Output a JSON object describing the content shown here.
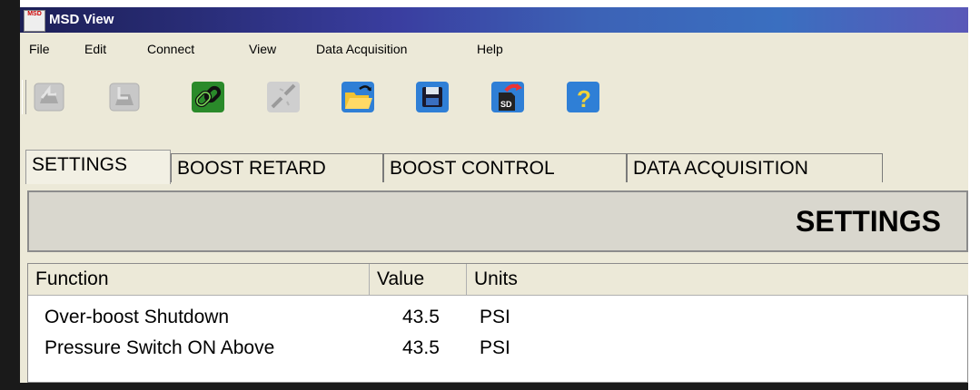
{
  "window": {
    "title": "MSD View",
    "icon_text": "MSD"
  },
  "menu": [
    "File",
    "Edit",
    "Connect",
    "View",
    "Data Acquisition",
    "Help"
  ],
  "toolbar": {
    "buttons": [
      {
        "icon": "read-from-device-icon",
        "enabled": false
      },
      {
        "icon": "write-to-device-icon",
        "enabled": false
      },
      {
        "icon": "connect-chain-icon",
        "enabled": true
      },
      {
        "icon": "disconnect-icon",
        "enabled": false
      },
      {
        "icon": "open-folder-icon",
        "enabled": true
      },
      {
        "icon": "save-floppy-icon",
        "enabled": true
      },
      {
        "icon": "sd-card-export-icon",
        "enabled": true,
        "label": "SD"
      },
      {
        "icon": "help-question-icon",
        "enabled": true,
        "label": "?"
      }
    ]
  },
  "tabs": [
    "SETTINGS",
    "BOOST RETARD",
    "BOOST CONTROL",
    "DATA ACQUISITION"
  ],
  "active_tab": "SETTINGS",
  "banner": {
    "title": "SETTINGS"
  },
  "table": {
    "columns": [
      "Function",
      "Value",
      "Units"
    ],
    "rows": [
      {
        "function": "Over-boost Shutdown",
        "value": "43.5",
        "units": "PSI"
      },
      {
        "function": "Pressure Switch ON Above",
        "value": "43.5",
        "units": "PSI"
      }
    ]
  },
  "colors": {
    "titlebar_start": "#1c1f56",
    "titlebar_end": "#3a6fc0",
    "face": "#ece9d8",
    "link_green": "#4caf2a",
    "icon_blue": "#2f7fd6"
  }
}
